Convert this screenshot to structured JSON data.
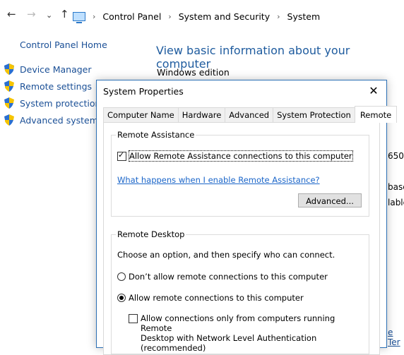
{
  "nav": {
    "back": "←",
    "forward": "→",
    "recent": "⌄",
    "up": "↑"
  },
  "breadcrumb": [
    "Control Panel",
    "System and Security",
    "System"
  ],
  "breadcrumb_sep": "›",
  "sidebar": {
    "home": "Control Panel Home",
    "items": [
      {
        "label": "Device Manager"
      },
      {
        "label": "Remote settings"
      },
      {
        "label": "System protection"
      },
      {
        "label": "Advanced system se"
      }
    ]
  },
  "main": {
    "title": "View basic information about your computer",
    "edition_label": "Windows edition",
    "frag_650": "650",
    "frag_base": "base",
    "frag_lable": "lable",
    "frag_ter": "e Ter"
  },
  "dialog": {
    "title": "System Properties",
    "close": "✕",
    "tabs": [
      "Computer Name",
      "Hardware",
      "Advanced",
      "System Protection",
      "Remote"
    ],
    "remote_assistance": {
      "group_label": "Remote Assistance",
      "allow_label": "Allow Remote Assistance connections to this computer",
      "allow_checked": true,
      "help_link": "What happens when I enable Remote Assistance?",
      "advanced_button": "Advanced..."
    },
    "remote_desktop": {
      "group_label": "Remote Desktop",
      "instruction": "Choose an option, and then specify who can connect.",
      "option_dont": "Don’t allow remote connections to this computer",
      "option_allow": "Allow remote connections to this computer",
      "selected": "allow",
      "nla_line1": "Allow connections only from computers running Remote",
      "nla_line2": "Desktop with Network Level Authentication (recommended)",
      "nla_checked": false
    }
  },
  "colors": {
    "accent": "#1a65c9",
    "link": "#1a4f96",
    "title_blue": "#1e5b9e",
    "dialog_border": "#2b6fb4"
  }
}
